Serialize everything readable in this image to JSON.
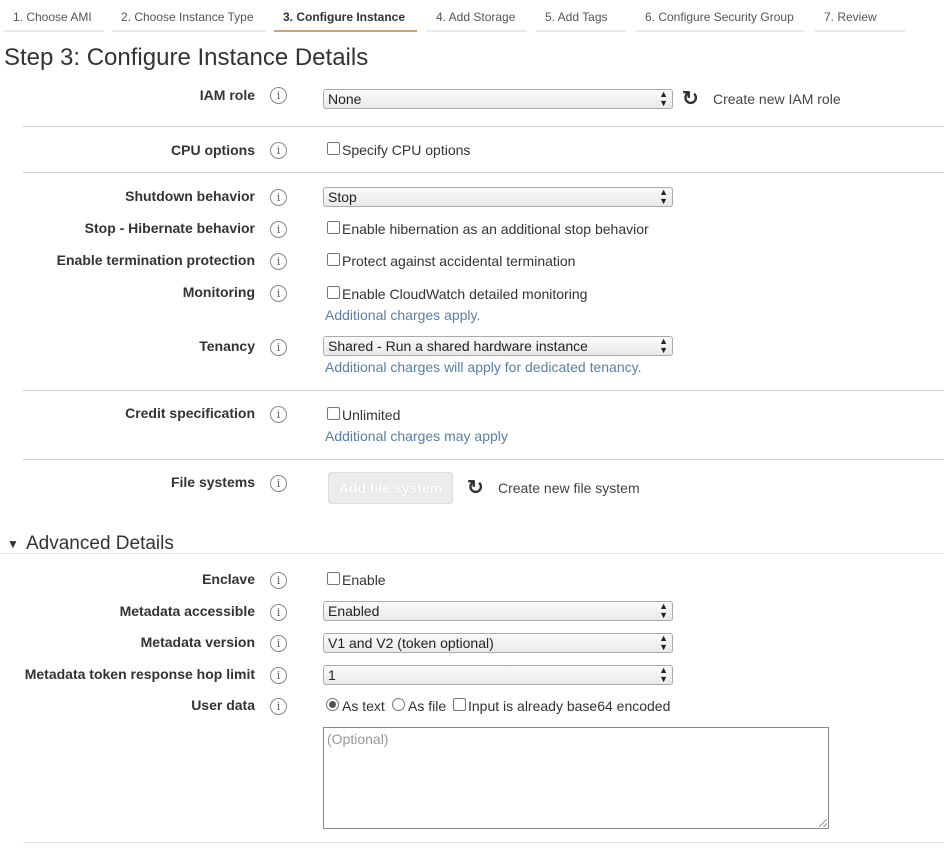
{
  "wizard": {
    "tabs": [
      {
        "label": "1. Choose AMI"
      },
      {
        "label": "2. Choose Instance Type"
      },
      {
        "label": "3. Configure Instance"
      },
      {
        "label": "4. Add Storage"
      },
      {
        "label": "5. Add Tags"
      },
      {
        "label": "6. Configure Security Group"
      },
      {
        "label": "7. Review"
      }
    ],
    "active_index": 2
  },
  "page_title": "Step 3: Configure Instance Details",
  "info_glyph": "i",
  "iam_role": {
    "label": "IAM role",
    "value": "None",
    "create_link": "Create new IAM role"
  },
  "cpu_options": {
    "label": "CPU options",
    "checkbox_label": "Specify CPU options",
    "checked": false
  },
  "shutdown": {
    "label": "Shutdown behavior",
    "value": "Stop"
  },
  "hibernate": {
    "label": "Stop - Hibernate behavior",
    "checkbox_label": "Enable hibernation as an additional stop behavior",
    "checked": false
  },
  "termination": {
    "label": "Enable termination protection",
    "checkbox_label": "Protect against accidental termination",
    "checked": false
  },
  "monitoring": {
    "label": "Monitoring",
    "checkbox_label": "Enable CloudWatch detailed monitoring",
    "note": "Additional charges apply.",
    "checked": false
  },
  "tenancy": {
    "label": "Tenancy",
    "value": "Shared - Run a shared hardware instance",
    "note": "Additional charges will apply for dedicated tenancy."
  },
  "credit": {
    "label": "Credit specification",
    "checkbox_label": "Unlimited",
    "note": "Additional charges may apply",
    "checked": false
  },
  "file_systems": {
    "label": "File systems",
    "add_button": "Add file system",
    "create_link": "Create new file system"
  },
  "advanced": {
    "title": "Advanced Details",
    "expanded": true
  },
  "enclave": {
    "label": "Enclave",
    "checkbox_label": "Enable",
    "checked": false
  },
  "metadata_accessible": {
    "label": "Metadata accessible",
    "value": "Enabled"
  },
  "metadata_version": {
    "label": "Metadata version",
    "value": "V1 and V2 (token optional)"
  },
  "hop_limit": {
    "label": "Metadata token response hop limit",
    "value": "1"
  },
  "user_data": {
    "label": "User data",
    "as_text": "As text",
    "as_file": "As file",
    "base64_label": "Input is already base64 encoded",
    "selected": "As text",
    "placeholder": "(Optional)"
  },
  "colors": {
    "accent_tab": "#c9a277",
    "note_text": "#5a7fa4"
  },
  "icons": {
    "info": "info-icon",
    "refresh": "refresh-icon",
    "select_arrows": "select-arrows-icon",
    "caret": "caret-down-icon"
  }
}
